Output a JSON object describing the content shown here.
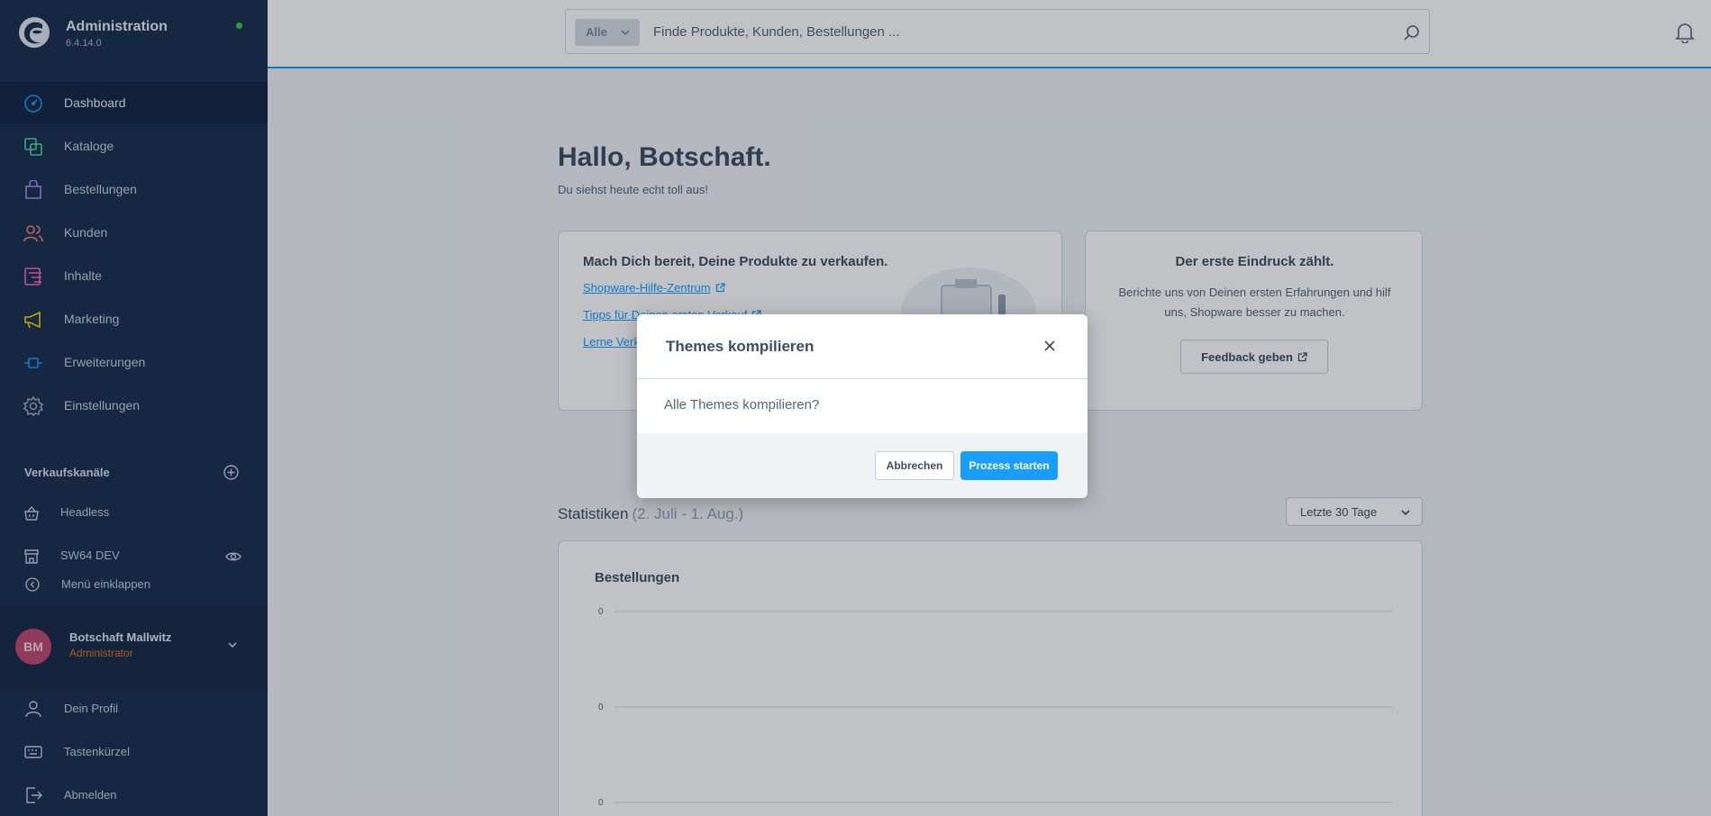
{
  "app": {
    "title": "Administration",
    "version": "6.4.14.0",
    "status_color": "#37d046"
  },
  "sidebar": {
    "items": [
      {
        "label": "Dashboard",
        "icon": "dashboard-icon",
        "color": "#189eff",
        "active": true
      },
      {
        "label": "Kataloge",
        "icon": "catalog-icon",
        "color": "#57d9a3"
      },
      {
        "label": "Bestellungen",
        "icon": "orders-icon",
        "color": "#a092f0"
      },
      {
        "label": "Kunden",
        "icon": "customers-icon",
        "color": "#f88962"
      },
      {
        "label": "Inhalte",
        "icon": "content-icon",
        "color": "#ff68b4"
      },
      {
        "label": "Marketing",
        "icon": "marketing-icon",
        "color": "#ffd700"
      },
      {
        "label": "Erweiterungen",
        "icon": "extensions-icon",
        "color": "#189eff"
      },
      {
        "label": "Einstellungen",
        "icon": "settings-icon",
        "color": "#9aa8b5"
      }
    ],
    "sales_channels": {
      "title": "Verkaufskanäle",
      "items": [
        {
          "label": "Headless",
          "icon": "basket-icon"
        },
        {
          "label": "SW64 DEV",
          "icon": "storefront-icon"
        }
      ]
    },
    "collapse_label": "Menü einklappen",
    "user": {
      "initials": "BM",
      "name": "Botschaft Mallwitz",
      "role": "Administrator"
    },
    "user_menu": [
      {
        "label": "Dein Profil",
        "icon": "profile-icon"
      },
      {
        "label": "Tastenkürzel",
        "icon": "keyboard-icon"
      },
      {
        "label": "Abmelden",
        "icon": "logout-icon"
      }
    ]
  },
  "search": {
    "filter_label": "Alle",
    "placeholder": "Finde Produkte, Kunden, Bestellungen ..."
  },
  "dashboard": {
    "greeting": "Hallo, Botschaft.",
    "sub_greeting": "Du siehst heute echt toll aus!",
    "getting_started": {
      "heading": "Mach Dich bereit, Deine Produkte zu verkaufen.",
      "links": [
        "Shopware-Hilfe-Zentrum",
        "Tipps für Deinen ersten Verkauf",
        "Lerne Verkaufen"
      ]
    },
    "feedback": {
      "heading": "Der erste Eindruck zählt.",
      "body": "Berichte uns von Deinen ersten Erfahrungen und hilf uns, Shopware besser zu machen.",
      "button": "Feedback geben"
    },
    "statistics": {
      "title": "Statistiken",
      "range": "(2. Juli - 1. Aug.)",
      "select_value": "Letzte 30 Tage"
    }
  },
  "chart_data": {
    "type": "line",
    "title": "Bestellungen",
    "y_ticks": [
      "0",
      "0",
      "0"
    ],
    "series": [
      {
        "values": []
      }
    ],
    "grid": true
  },
  "modal": {
    "title": "Themes kompilieren",
    "body": "Alle Themes kompilieren?",
    "cancel": "Abbrechen",
    "confirm": "Prozess starten",
    "primary_color": "#189eff"
  }
}
